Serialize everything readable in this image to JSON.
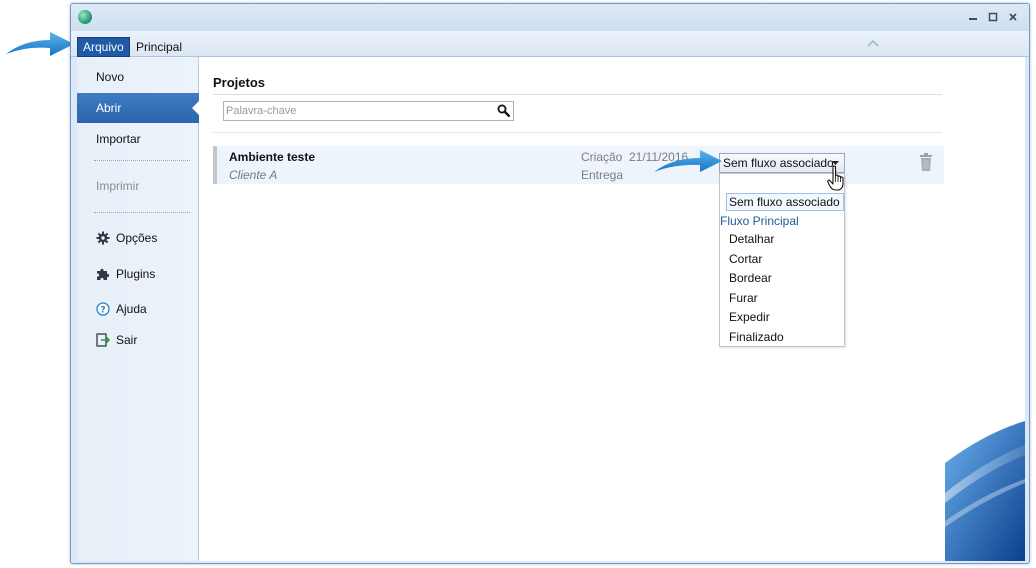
{
  "window": {
    "title_icon": "app-logo-icon",
    "controls": [
      "minimize-icon",
      "maximize-icon",
      "close-icon"
    ]
  },
  "ribbon": {
    "tabs": [
      {
        "label": "Arquivo",
        "active": true
      },
      {
        "label": "Principal",
        "active": false
      }
    ]
  },
  "backstage": {
    "items": [
      {
        "label": "Novo",
        "icon": "",
        "state": "normal"
      },
      {
        "label": "Abrir",
        "icon": "",
        "state": "active"
      },
      {
        "label": "Importar",
        "icon": "",
        "state": "normal"
      },
      {
        "label": "Imprimir",
        "icon": "",
        "state": "disabled"
      },
      {
        "label": "Opções",
        "icon": "gear-icon",
        "state": "normal"
      },
      {
        "label": "Plugins",
        "icon": "puzzle-icon",
        "state": "normal"
      },
      {
        "label": "Ajuda",
        "icon": "help-icon",
        "state": "normal"
      },
      {
        "label": "Sair",
        "icon": "exit-icon",
        "state": "normal"
      }
    ]
  },
  "main": {
    "title": "Projetos",
    "search": {
      "placeholder": "Palavra-chave",
      "value": ""
    },
    "projects": [
      {
        "name": "Ambiente teste",
        "client": "Cliente A",
        "created_label": "Criação",
        "created_date": "21/11/2016",
        "delivery_label": "Entrega",
        "flow_selected": "Sem fluxo associado"
      }
    ],
    "flow_dropdown": {
      "options": [
        {
          "label": "Sem fluxo associado",
          "kind": "selected"
        },
        {
          "label": "Fluxo Principal",
          "kind": "group"
        },
        {
          "label": "Detalhar",
          "kind": "child"
        },
        {
          "label": "Cortar",
          "kind": "child"
        },
        {
          "label": "Bordear",
          "kind": "child"
        },
        {
          "label": "Furar",
          "kind": "child"
        },
        {
          "label": "Expedir",
          "kind": "child"
        },
        {
          "label": "Finalizado",
          "kind": "child"
        }
      ]
    }
  },
  "colors": {
    "accent": "#2b65ad",
    "annotation_arrow": "#1f8ad6",
    "window_border": "#6e9ccc"
  }
}
